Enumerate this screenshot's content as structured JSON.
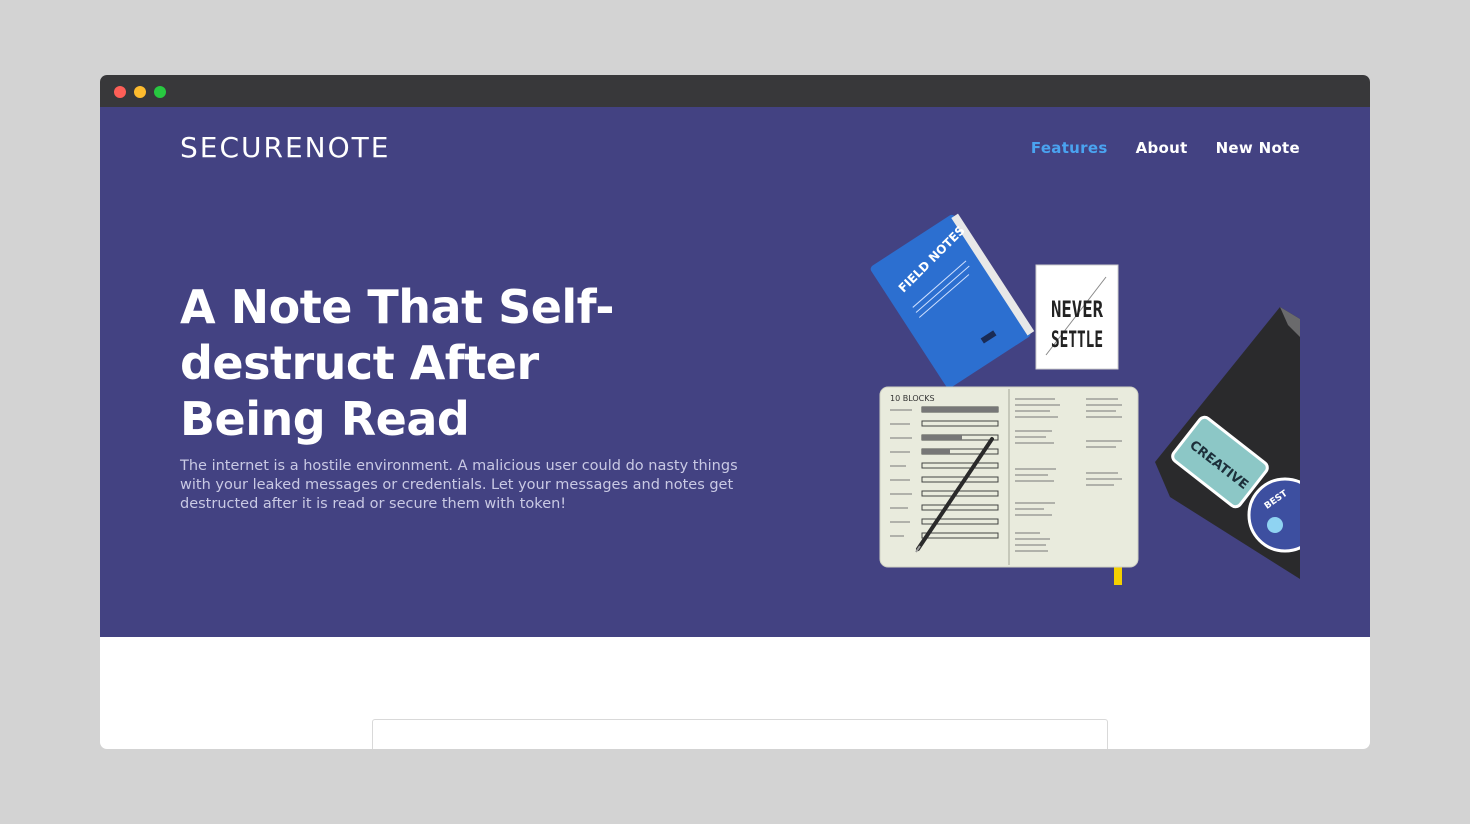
{
  "brand": {
    "name": "SECURENOTE"
  },
  "nav": {
    "items": [
      {
        "label": "Features",
        "active": true
      },
      {
        "label": "About",
        "active": false
      },
      {
        "label": "New Note",
        "active": false
      }
    ]
  },
  "hero": {
    "title": "A Note That Self-destruct After Being Read",
    "description": "The internet is a hostile environment. A malicious user could do nasty things with your leaked messages or credentials. Let your messages and notes get destructed after it is read or secure them with token!"
  },
  "illustration": {
    "field_notes_text": "FIELD NOTES",
    "poster_text_1": "NEVER",
    "poster_text_2": "SETTLE",
    "notebook_heading": "10 BLOCKS",
    "laptop_sticker_text": "CREATIVE",
    "laptop_badge_text": "BEST"
  },
  "colors": {
    "hero_bg": "#434282",
    "nav_active": "#4aa3f0",
    "titlebar": "#38383a"
  }
}
